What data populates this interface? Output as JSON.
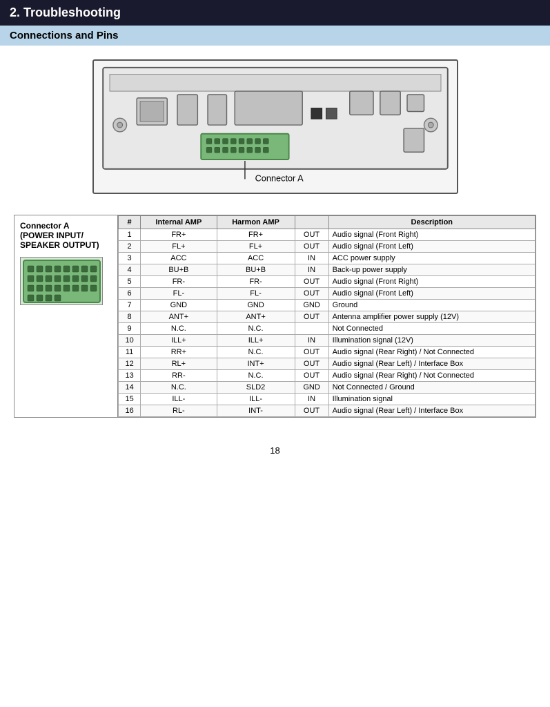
{
  "header": {
    "title": "2. Troubleshooting"
  },
  "section": {
    "title": "Connections and Pins"
  },
  "diagram": {
    "connector_label": "Connector A"
  },
  "table": {
    "connector_title": "Connector A\n(POWER INPUT/\nSPEAKER OUTPUT)",
    "connector_line1": "Connector A",
    "connector_line2": "(POWER INPUT/",
    "connector_line3": "SPEAKER OUTPUT)",
    "columns": [
      "#",
      "Internal AMP",
      "Harmon AMP",
      "",
      "Description"
    ],
    "rows": [
      [
        "1",
        "FR+",
        "FR+",
        "OUT",
        "Audio signal (Front Right)"
      ],
      [
        "2",
        "FL+",
        "FL+",
        "OUT",
        "Audio signal (Front Left)"
      ],
      [
        "3",
        "ACC",
        "ACC",
        "IN",
        "ACC power supply"
      ],
      [
        "4",
        "BU+B",
        "BU+B",
        "IN",
        "Back-up power supply"
      ],
      [
        "5",
        "FR-",
        "FR-",
        "OUT",
        "Audio signal (Front Right)"
      ],
      [
        "6",
        "FL-",
        "FL-",
        "OUT",
        "Audio signal (Front Left)"
      ],
      [
        "7",
        "GND",
        "GND",
        "GND",
        "Ground"
      ],
      [
        "8",
        "ANT+",
        "ANT+",
        "OUT",
        "Antenna amplifier power supply (12V)"
      ],
      [
        "9",
        "N.C.",
        "N.C.",
        "",
        "Not Connected"
      ],
      [
        "10",
        "ILL+",
        "ILL+",
        "IN",
        "Illumination signal (12V)"
      ],
      [
        "11",
        "RR+",
        "N.C.",
        "OUT",
        "Audio signal (Rear Right) / Not Connected"
      ],
      [
        "12",
        "RL+",
        "INT+",
        "OUT",
        "Audio signal (Rear Left) / Interface Box"
      ],
      [
        "13",
        "RR-",
        "N.C.",
        "OUT",
        "Audio signal (Rear Right) / Not Connected"
      ],
      [
        "14",
        "N.C.",
        "SLD2",
        "GND",
        "Not Connected / Ground"
      ],
      [
        "15",
        "ILL-",
        "ILL-",
        "IN",
        "Illumination signal"
      ],
      [
        "16",
        "RL-",
        "INT-",
        "OUT",
        "Audio signal (Rear Left) / Interface Box"
      ]
    ]
  },
  "page": {
    "number": "18"
  }
}
